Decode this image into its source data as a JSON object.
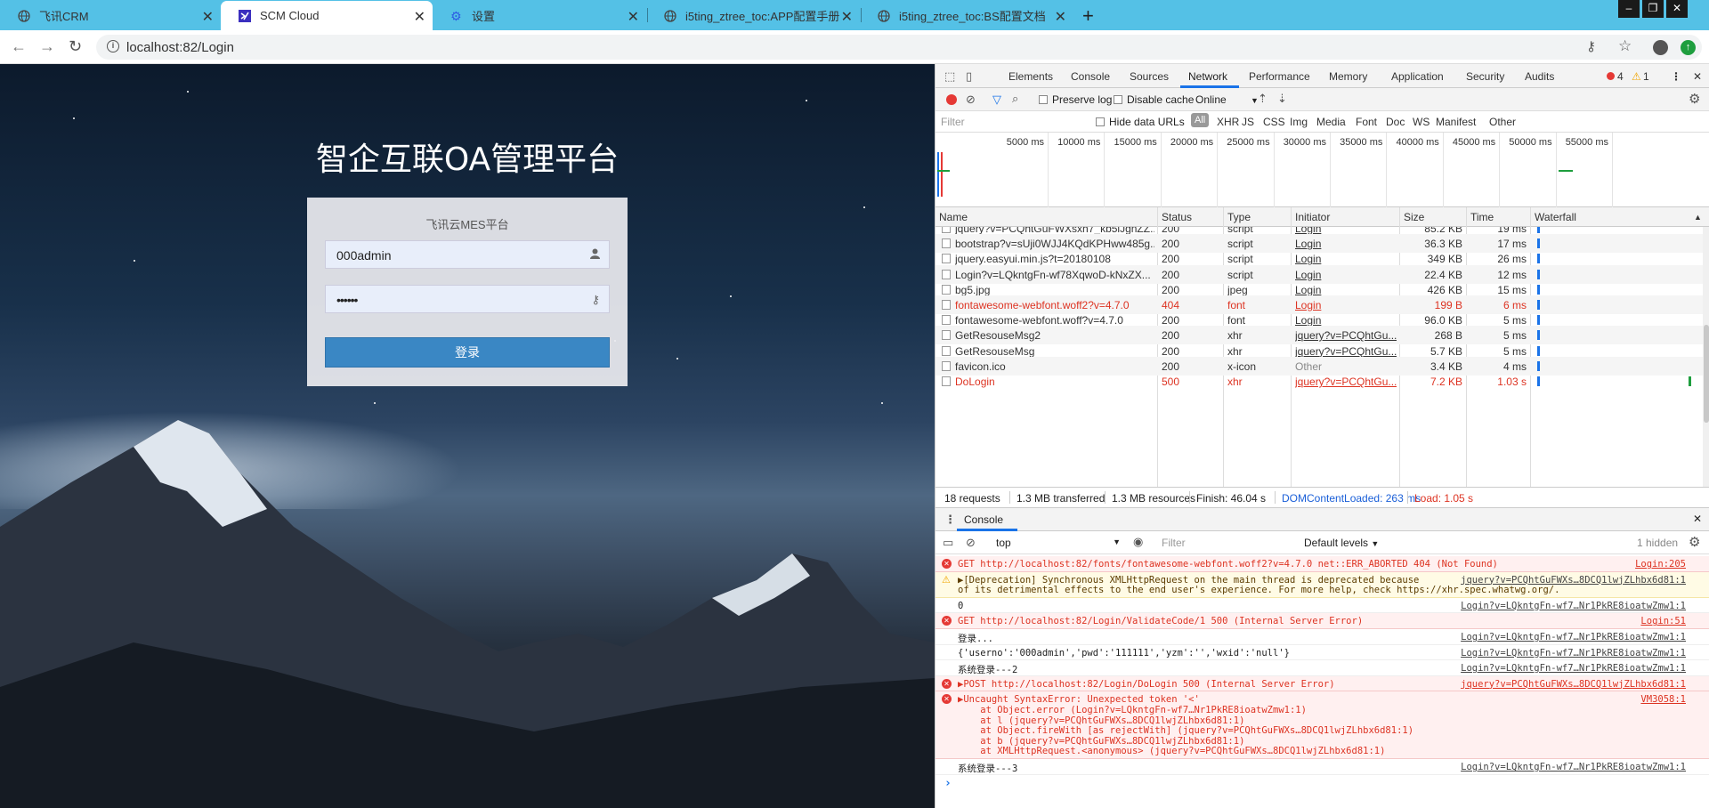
{
  "browser": {
    "tabs": [
      {
        "title": "飞讯CRM"
      },
      {
        "title": "SCM Cloud"
      },
      {
        "title": "设置"
      },
      {
        "title": "i5ting_ztree_toc:APP配置手册"
      },
      {
        "title": "i5ting_ztree_toc:BS配置文档"
      }
    ],
    "url": "localhost:82/Login"
  },
  "login": {
    "title": "智企互联OA管理平台",
    "subtitle": "飞讯云MES平台",
    "username": "000admin",
    "password": "••••••",
    "button": "登录"
  },
  "devtools": {
    "tabs": [
      "Elements",
      "Console",
      "Sources",
      "Network",
      "Performance",
      "Memory",
      "Application",
      "Security",
      "Audits"
    ],
    "active_tab": "Network",
    "error_count": "4",
    "warning_count": "1",
    "toolbar": {
      "preserve_log": "Preserve log",
      "disable_cache": "Disable cache",
      "throttle": "Online"
    },
    "filter": {
      "placeholder": "Filter",
      "hide_data_urls": "Hide data URLs",
      "types": [
        "All",
        "XHR",
        "JS",
        "CSS",
        "Img",
        "Media",
        "Font",
        "Doc",
        "WS",
        "Manifest",
        "Other"
      ]
    },
    "timeline_ticks": [
      "5000 ms",
      "10000 ms",
      "15000 ms",
      "20000 ms",
      "25000 ms",
      "30000 ms",
      "35000 ms",
      "40000 ms",
      "45000 ms",
      "50000 ms",
      "55000 ms"
    ],
    "columns": [
      "Name",
      "Status",
      "Type",
      "Initiator",
      "Size",
      "Time",
      "Waterfall"
    ],
    "requests": [
      {
        "name": "jquery?v=PCQhtGuFWXsxh7_kb5lJgnZZ...",
        "status": "200",
        "type": "script",
        "initiator": "Login",
        "size": "85.2 KB",
        "time": "19 ms",
        "error": false
      },
      {
        "name": "bootstrap?v=sUji0WJJ4KQdKPHww485g...",
        "status": "200",
        "type": "script",
        "initiator": "Login",
        "size": "36.3 KB",
        "time": "17 ms",
        "error": false
      },
      {
        "name": "jquery.easyui.min.js?t=20180108",
        "status": "200",
        "type": "script",
        "initiator": "Login",
        "size": "349 KB",
        "time": "26 ms",
        "error": false
      },
      {
        "name": "Login?v=LQkntgFn-wf78XqwoD-kNxZX...",
        "status": "200",
        "type": "script",
        "initiator": "Login",
        "size": "22.4 KB",
        "time": "12 ms",
        "error": false
      },
      {
        "name": "bg5.jpg",
        "status": "200",
        "type": "jpeg",
        "initiator": "Login",
        "size": "426 KB",
        "time": "15 ms",
        "error": false
      },
      {
        "name": "fontawesome-webfont.woff2?v=4.7.0",
        "status": "404",
        "type": "font",
        "initiator": "Login",
        "size": "199 B",
        "time": "6 ms",
        "error": true
      },
      {
        "name": "fontawesome-webfont.woff?v=4.7.0",
        "status": "200",
        "type": "font",
        "initiator": "Login",
        "size": "96.0 KB",
        "time": "5 ms",
        "error": false
      },
      {
        "name": "GetResouseMsg2",
        "status": "200",
        "type": "xhr",
        "initiator": "jquery?v=PCQhtGu...",
        "size": "268 B",
        "time": "5 ms",
        "error": false
      },
      {
        "name": "GetResouseMsg",
        "status": "200",
        "type": "xhr",
        "initiator": "jquery?v=PCQhtGu...",
        "size": "5.7 KB",
        "time": "5 ms",
        "error": false
      },
      {
        "name": "favicon.ico",
        "status": "200",
        "type": "x-icon",
        "initiator": "Other",
        "size": "3.4 KB",
        "time": "4 ms",
        "error": false
      },
      {
        "name": "DoLogin",
        "status": "500",
        "type": "xhr",
        "initiator": "jquery?v=PCQhtGu...",
        "size": "7.2 KB",
        "time": "1.03 s",
        "error": true
      }
    ],
    "summary": {
      "requests": "18 requests",
      "transferred": "1.3 MB transferred",
      "resources": "1.3 MB resources",
      "finish": "Finish: 46.04 s",
      "dcl": "DOMContentLoaded: 263 ms",
      "load": "Load: 1.05 s"
    },
    "console": {
      "tab": "Console",
      "context": "top",
      "filter_placeholder": "Filter",
      "levels": "Default levels",
      "hidden": "1 hidden",
      "messages": [
        {
          "kind": "error",
          "lines": [
            "GET http://localhost:82/fonts/fontawesome-webfont.woff2?v=4.7.0 net::ERR_ABORTED 404 (Not Found)"
          ],
          "source": "Login:205"
        },
        {
          "kind": "warning",
          "lines": [
            "▶[Deprecation] Synchronous XMLHttpRequest on the main thread is deprecated because",
            "of its detrimental effects to the end user's experience. For more help, check https://xhr.spec.whatwg.org/."
          ],
          "source": "jquery?v=PCQhtGuFWXs…8DCQ1lwjZLhbx6d81:1"
        },
        {
          "kind": "log",
          "lines": [
            "0"
          ],
          "source": "Login?v=LQkntgFn-wf7…Nr1PkRE8ioatwZmw1:1"
        },
        {
          "kind": "error",
          "lines": [
            "GET http://localhost:82/Login/ValidateCode/1 500 (Internal Server Error)"
          ],
          "source": "Login:51"
        },
        {
          "kind": "log",
          "lines": [
            "登录..."
          ],
          "source": "Login?v=LQkntgFn-wf7…Nr1PkRE8ioatwZmw1:1"
        },
        {
          "kind": "log",
          "lines": [
            "{'userno':'000admin','pwd':'111111','yzm':'','wxid':'null'}"
          ],
          "source": "Login?v=LQkntgFn-wf7…Nr1PkRE8ioatwZmw1:1"
        },
        {
          "kind": "log",
          "lines": [
            "系统登录---2"
          ],
          "source": "Login?v=LQkntgFn-wf7…Nr1PkRE8ioatwZmw1:1"
        },
        {
          "kind": "error",
          "lines": [
            "▶POST http://localhost:82/Login/DoLogin 500 (Internal Server Error)"
          ],
          "source": "jquery?v=PCQhtGuFWXs…8DCQ1lwjZLhbx6d81:1"
        },
        {
          "kind": "error",
          "lines": [
            "▶Uncaught SyntaxError: Unexpected token '<'",
            "    at Object.error (Login?v=LQkntgFn-wf7…Nr1PkRE8ioatwZmw1:1)",
            "    at l (jquery?v=PCQhtGuFWXs…8DCQ1lwjZLhbx6d81:1)",
            "    at Object.fireWith [as rejectWith] (jquery?v=PCQhtGuFWXs…8DCQ1lwjZLhbx6d81:1)",
            "    at b (jquery?v=PCQhtGuFWXs…8DCQ1lwjZLhbx6d81:1)",
            "    at XMLHttpRequest.<anonymous> (jquery?v=PCQhtGuFWXs…8DCQ1lwjZLhbx6d81:1)"
          ],
          "source": "VM3058:1"
        },
        {
          "kind": "log",
          "lines": [
            "系统登录---3"
          ],
          "source": "Login?v=LQkntgFn-wf7…Nr1PkRE8ioatwZmw1:1"
        }
      ]
    }
  }
}
